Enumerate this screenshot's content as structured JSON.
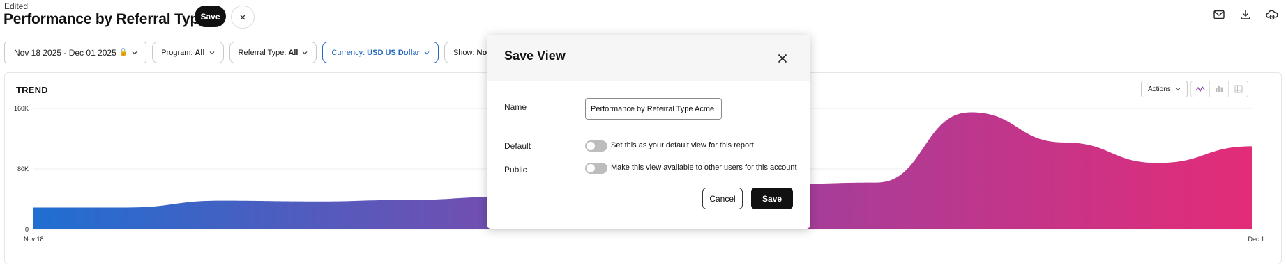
{
  "header": {
    "status": "Edited",
    "title": "Performance by Referral Type",
    "save_label": "Save"
  },
  "filters": {
    "date_range": "Nov 18 2025 - Dec 01 2025",
    "program": {
      "label": "Program:",
      "value": "All"
    },
    "referral_type": {
      "label": "Referral Type:",
      "value": "All"
    },
    "currency": {
      "label": "Currency:",
      "value": "USD US Dollar"
    },
    "show": {
      "label": "Show:",
      "value": "None"
    }
  },
  "trend_card": {
    "title": "TREND",
    "actions_label": "Actions"
  },
  "chart_data": {
    "type": "area",
    "title": "TREND",
    "xlabel": "",
    "ylabel": "",
    "x_tick_labels": [
      "Nov 18",
      "Dec 1"
    ],
    "y_tick_labels": [
      "0",
      "80K",
      "160K"
    ],
    "ylim": [
      0,
      160000
    ],
    "grid": true,
    "gradient_colors": [
      "#1f6fd1",
      "#8e44a6",
      "#e32c78"
    ],
    "x": [
      "Nov 18",
      "Nov 19",
      "Nov 20",
      "Nov 21",
      "Nov 22",
      "Nov 23",
      "Nov 24",
      "Nov 25",
      "Nov 26",
      "Nov 27",
      "Nov 28",
      "Nov 29",
      "Nov 30",
      "Dec 1"
    ],
    "series": [
      {
        "values": [
          29000,
          29000,
          38000,
          37000,
          39000,
          43000,
          48000,
          55000,
          60000,
          62000,
          155000,
          115000,
          88000,
          110000
        ]
      }
    ]
  },
  "modal": {
    "title": "Save View",
    "name_label": "Name",
    "name_value": "Performance by Referral Type Acme C",
    "default_label": "Default",
    "default_text": "Set this as your default view for this report",
    "public_label": "Public",
    "public_text": "Make this view available to other users for this account",
    "cancel_label": "Cancel",
    "save_label": "Save"
  }
}
